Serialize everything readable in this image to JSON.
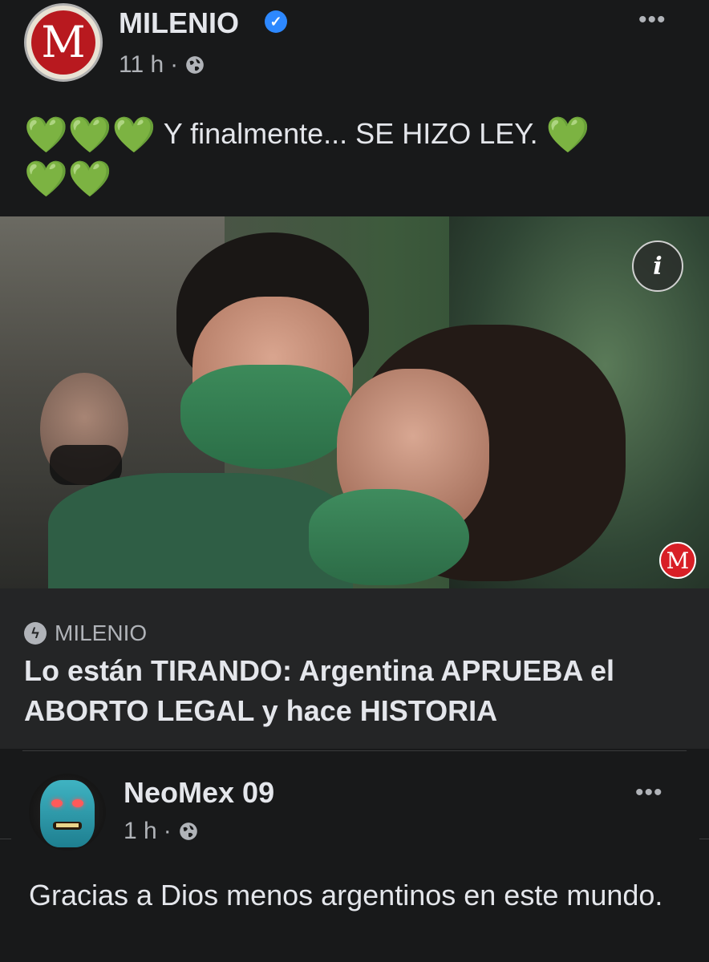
{
  "post": {
    "page_name": "MILENIO",
    "avatar_letter": "M",
    "time": "11 h",
    "dot": "·",
    "more": "•••",
    "text_line1_hearts": "💚💚💚",
    "text_line1": " Y finalmente... SE HIZO LEY. ",
    "text_line1_end_heart": "💚",
    "text_line2_hearts": "💚💚",
    "privacy_icon": "globe-icon"
  },
  "photo": {
    "info_label": "i",
    "logo_letter": "M"
  },
  "link": {
    "source": "MILENIO",
    "title": "Lo están TIRANDO: Argentina APRUEBA el ABORTO LEGAL y hace HISTORIA"
  },
  "comment": {
    "author": "NeoMex 09",
    "time": "1 h",
    "dot": "·",
    "more": "•••",
    "text": "Gracias a Dios menos argentinos en este mundo."
  },
  "colors": {
    "background": "#18191a",
    "card": "#242526",
    "text_primary": "#e4e6eb",
    "text_secondary": "#b0b3b8",
    "verified": "#2d88ff",
    "heart": "#5fd12b",
    "brand_red": "#b8191f"
  }
}
